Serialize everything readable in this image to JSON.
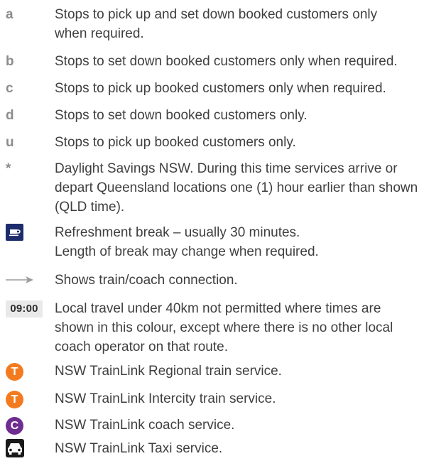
{
  "legend": {
    "a": {
      "key": "a",
      "line1": "Stops to pick up and set down booked customers only",
      "line2": "when required."
    },
    "b": {
      "key": "b",
      "text": "Stops to set down booked customers only when required."
    },
    "c": {
      "key": "c",
      "text": "Stops to pick up booked customers only when required."
    },
    "d": {
      "key": "d",
      "text": "Stops to set down booked customers only."
    },
    "u": {
      "key": "u",
      "text": "Stops to pick up booked customers only."
    },
    "star": {
      "key": "*",
      "line1": "Daylight Savings NSW. During this time services arrive or",
      "line2": "depart Queensland locations one (1) hour earlier than shown",
      "line3": "(QLD time)."
    },
    "refreshment": {
      "icon": "coffee-cup-icon",
      "line1": "Refreshment break – usually 30 minutes.",
      "line2": "Length of break may change when required."
    },
    "connection": {
      "icon": "arrow-right-icon",
      "text": "Shows train/coach connection."
    },
    "local_travel": {
      "badge": "09:00",
      "line1": "Local travel under 40km not permitted where times are",
      "line2": "shown in this colour, except where there is no other local",
      "line3": "coach operator on that route."
    },
    "regional_train": {
      "icon": "train-icon",
      "badge_letter": "T",
      "color": "#f47a20",
      "text": "NSW TrainLink Regional train service."
    },
    "intercity_train": {
      "icon": "train-icon",
      "badge_letter": "T",
      "color": "#f47a20",
      "text": "NSW TrainLink Intercity train service."
    },
    "coach": {
      "icon": "coach-icon",
      "badge_letter": "C",
      "color": "#6f2c91",
      "text": "NSW TrainLink coach service."
    },
    "taxi": {
      "icon": "taxi-icon",
      "text": "NSW TrainLink Taxi service."
    }
  }
}
